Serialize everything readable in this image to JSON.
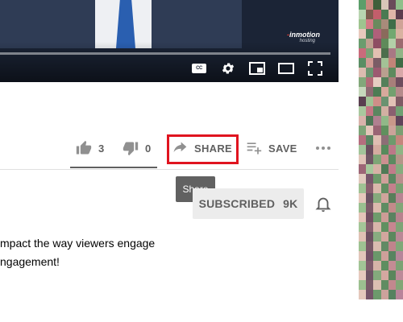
{
  "player": {
    "logo_prefix": "-",
    "logo_text": "inmotion",
    "logo_sub": "hosting",
    "cc_label": "CC"
  },
  "actions": {
    "like_count": "3",
    "dislike_count": "0",
    "share_label": "SHARE",
    "save_label": "SAVE",
    "like_ratio": 1.0
  },
  "tooltip": {
    "text": "Share"
  },
  "subscribe": {
    "label": "SUBSCRIBED",
    "count": "9K"
  },
  "description": {
    "line1": "mpact the way viewers engage",
    "line2": "ngagement!"
  },
  "colors": {
    "highlight": "#e0141f",
    "sidebar_pixels": [
      "#5b9e6a",
      "#c98a7f",
      "#3f5f3a",
      "#d9c6b8",
      "#6a4b5a",
      "#8fbf8a",
      "#b8d4b0",
      "#7d5b4e",
      "#c25e6b",
      "#4a7a52",
      "#e0b6a8",
      "#5c3d4d",
      "#9ec48f",
      "#d47a86",
      "#6b8a5e",
      "#a88b7a",
      "#3e6e48",
      "#cfa396",
      "#e8c9bd",
      "#4f7f5a",
      "#b0607a",
      "#8a6b5c",
      "#72a870",
      "#d8b2a0",
      "#6a9c6e",
      "#c0a090",
      "#8e4e63",
      "#5f8a5a",
      "#b3cfa8",
      "#9b6b6f",
      "#c96b7b",
      "#7aa276",
      "#e2c0b2",
      "#4d6e4c",
      "#a87884",
      "#91b486",
      "#5a8e64",
      "#d19b94",
      "#7b5c66",
      "#a3c296",
      "#c28478",
      "#3f6b45",
      "#dcbcb0",
      "#6c9470",
      "#9c5a70",
      "#b9a08f",
      "#5e8a5e",
      "#d8a8a8",
      "#82a87a",
      "#b46b78",
      "#e6cdc2",
      "#54805a",
      "#a77f7a",
      "#6e4d5e",
      "#c6d8bc",
      "#8d6a72",
      "#4c7c54",
      "#d7a99c",
      "#73a06f",
      "#b58a8a",
      "#5a3f50",
      "#9fc294",
      "#cf8e88",
      "#6a9270",
      "#e1c2b6",
      "#7e5a64",
      "#a9c89e",
      "#c47684",
      "#5b8660",
      "#d2b0a2",
      "#8a6070",
      "#6fa072",
      "#d9b3ab",
      "#4e7656",
      "#b08090",
      "#91b888",
      "#c8988a",
      "#5f445a",
      "#7ea478",
      "#e4c6ba",
      "#9a6474",
      "#60905e",
      "#cba39a",
      "#7b9e72",
      "#b56e7e",
      "#5a8462",
      "#dfbeb2",
      "#8c6e76",
      "#6d9a6c",
      "#c4867c",
      "#a2c49a",
      "#6a4e5e",
      "#d4aca0",
      "#578a5c",
      "#bb7888",
      "#8fb484",
      "#e0c4b8",
      "#6f5664",
      "#7ea676",
      "#cc9090",
      "#5c8a60",
      "#b49688",
      "#9d6676",
      "#a6c89c",
      "#d6b2a6",
      "#4f7a56",
      "#c07c8a",
      "#86ac7e",
      "#e2cabe",
      "#76566a",
      "#6c9a6a",
      "#cfa09a",
      "#5a8660",
      "#b98e8c",
      "#a0c294",
      "#8a5e6e",
      "#dab8ac",
      "#628e62",
      "#c4808c",
      "#7aa072",
      "#e6c8bc",
      "#6a5262",
      "#85aa7c",
      "#d0a49c",
      "#587e5a",
      "#b78492",
      "#9ac090",
      "#7c5a68",
      "#dcbaae",
      "#5e8c62",
      "#c28a8a",
      "#82a678",
      "#e4c4b8",
      "#704e60",
      "#6e9c6c",
      "#cc9c96",
      "#5a8260",
      "#b8828e",
      "#a4c698",
      "#86606e",
      "#d8b6aa",
      "#609060",
      "#c68690",
      "#7ea476",
      "#e0c2b4",
      "#6c5060",
      "#88ac80",
      "#d2a69e",
      "#5c885e",
      "#ba8896",
      "#9ec292",
      "#785866",
      "#dabcb0",
      "#628a64",
      "#c0848c",
      "#80a878",
      "#e2c6ba",
      "#725266",
      "#6a986a",
      "#cea09a",
      "#588460",
      "#b6869a",
      "#a2c496",
      "#805c6c",
      "#d6b4a8",
      "#5e8e60",
      "#c48c94",
      "#7ca274",
      "#e6cabe",
      "#6e5464",
      "#84aa7c",
      "#d4a8a0",
      "#5a865c",
      "#bc8a98",
      "#9cc090",
      "#7a5a68",
      "#dcbeb2",
      "#608c62",
      "#c2888e",
      "#82a676",
      "#e4c8bc",
      "#745468",
      "#6c9a6c",
      "#cca29c",
      "#568260",
      "#b8849a"
    ]
  }
}
